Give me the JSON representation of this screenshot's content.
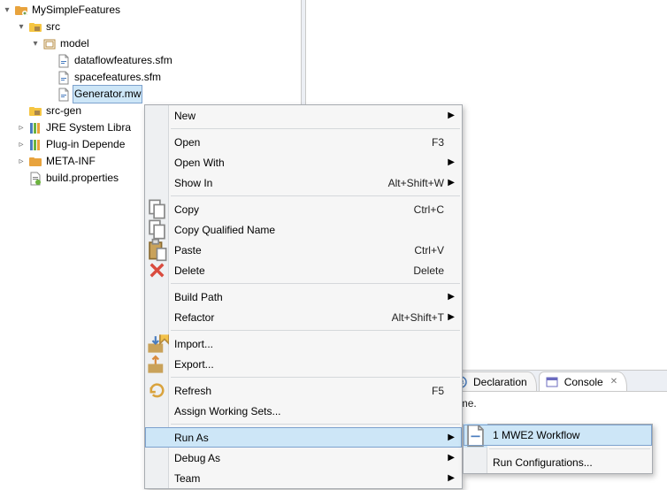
{
  "tree": {
    "project": "MySimpleFeatures",
    "src": "src",
    "model": "model",
    "file_dataflow": "dataflowfeatures.sfm",
    "file_space": "spacefeatures.sfm",
    "file_generator": "Generator.mw",
    "srcgen": "src-gen",
    "jre": "JRE System Libra",
    "plugin": "Plug-in Depende",
    "meta": "META-INF",
    "build": "build.properties"
  },
  "context_menu": {
    "new": "New",
    "open": "Open",
    "open_key": "F3",
    "open_with": "Open With",
    "show_in": "Show In",
    "show_in_key": "Alt+Shift+W",
    "copy": "Copy",
    "copy_key": "Ctrl+C",
    "copy_qualified": "Copy Qualified Name",
    "paste": "Paste",
    "paste_key": "Ctrl+V",
    "delete": "Delete",
    "delete_key": "Delete",
    "build_path": "Build Path",
    "refactor": "Refactor",
    "refactor_key": "Alt+Shift+T",
    "import": "Import...",
    "export": "Export...",
    "refresh": "Refresh",
    "refresh_key": "F5",
    "assign_ws": "Assign Working Sets...",
    "run_as": "Run As",
    "debug_as": "Debug As",
    "team": "Team"
  },
  "run_as_submenu": {
    "workflow": "1 MWE2 Workflow",
    "run_config": "Run Configurations..."
  },
  "bottom_tabs": {
    "declaration": "Declaration",
    "console": "Console"
  },
  "status_text": "his time."
}
